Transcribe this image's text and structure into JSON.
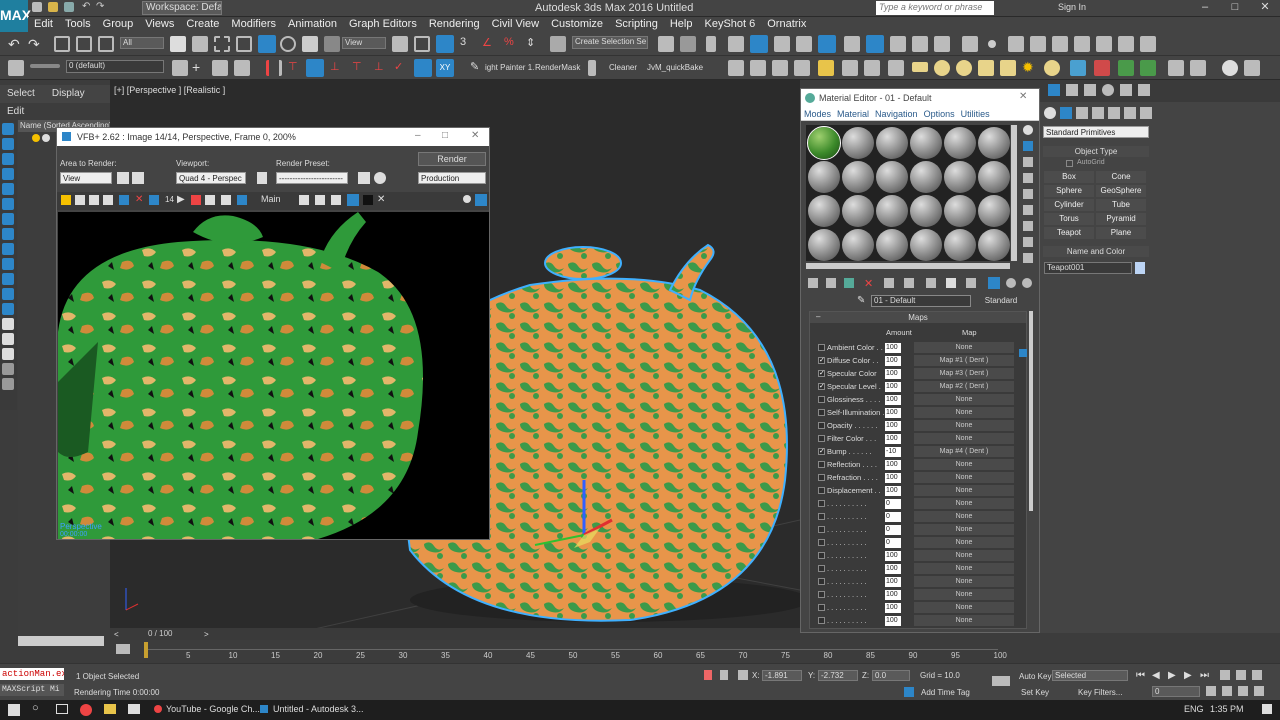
{
  "app": {
    "title": "Autodesk 3ds Max 2016    Untitled",
    "logo": "MAX",
    "workspace": "Workspace: Default",
    "search_placeholder": "Type a keyword or phrase",
    "sign_in": "Sign In"
  },
  "menu": [
    "Edit",
    "Tools",
    "Group",
    "Views",
    "Create",
    "Modifiers",
    "Animation",
    "Graph Editors",
    "Rendering",
    "Civil View",
    "Customize",
    "Scripting",
    "Help",
    "KeyShot 6",
    "Ornatrix"
  ],
  "toolbar": {
    "filter": "All",
    "view": "View",
    "create_selection_set": "Create Selection Se",
    "layer": "0 (default)",
    "scripts": [
      "ight Painter 1.",
      "RenderMask",
      "Cleaner",
      "JvM_quickBake"
    ]
  },
  "command_tabs": [
    "Select",
    "Display",
    "Edit"
  ],
  "scene_explorer": {
    "header": "Name (Sorted Ascending)"
  },
  "viewport": {
    "label": "[+] [Perspective ] [Realistic ]"
  },
  "vfb": {
    "title": "VFB+ 2.62 : Image 14/14, Perspective, Frame 0, 200%",
    "area_label": "Area to Render:",
    "area_value": "View",
    "viewport_label": "Viewport:",
    "viewport_value": "Quad 4 - Perspec",
    "preset_label": "Render Preset:",
    "preset_value": "------------------------",
    "render_button": "Render",
    "production": "Production",
    "frame_num": "14",
    "main_label": "Main",
    "overlay_view": "Perspective",
    "overlay_time": "00:00:00"
  },
  "material_editor": {
    "title": "Material Editor - 01 - Default",
    "menu": [
      "Modes",
      "Material",
      "Navigation",
      "Options",
      "Utilities"
    ],
    "material_name": "01 - Default",
    "material_type": "Standard",
    "maps_header": "Maps",
    "col_amount": "Amount",
    "col_map": "Map",
    "rows": [
      {
        "checked": false,
        "name": "Ambient Color . .",
        "amount": "100",
        "map": "None"
      },
      {
        "checked": true,
        "name": "Diffuse Color . .",
        "amount": "100",
        "map": "Map #1  ( Dent )"
      },
      {
        "checked": true,
        "name": "Specular Color",
        "amount": "100",
        "map": "Map #3  ( Dent )"
      },
      {
        "checked": true,
        "name": "Specular Level .",
        "amount": "100",
        "map": "Map #2  ( Dent )"
      },
      {
        "checked": false,
        "name": "Glossiness . . . .",
        "amount": "100",
        "map": "None"
      },
      {
        "checked": false,
        "name": "Self-Illumination .",
        "amount": "100",
        "map": "None"
      },
      {
        "checked": false,
        "name": "Opacity . . . . . .",
        "amount": "100",
        "map": "None"
      },
      {
        "checked": false,
        "name": "Filter Color . . .",
        "amount": "100",
        "map": "None"
      },
      {
        "checked": true,
        "name": "Bump . . . . . .",
        "amount": "-10",
        "map": "Map #4  ( Dent )"
      },
      {
        "checked": false,
        "name": "Reflection . . . .",
        "amount": "100",
        "map": "None"
      },
      {
        "checked": false,
        "name": "Refraction . . . .",
        "amount": "100",
        "map": "None"
      },
      {
        "checked": false,
        "name": "Displacement . .",
        "amount": "100",
        "map": "None"
      },
      {
        "checked": false,
        "name": ". . . . . . . . . .",
        "amount": "0",
        "map": "None"
      },
      {
        "checked": false,
        "name": ". . . . . . . . . .",
        "amount": "0",
        "map": "None"
      },
      {
        "checked": false,
        "name": ". . . . . . . . . .",
        "amount": "0",
        "map": "None"
      },
      {
        "checked": false,
        "name": ". . . . . . . . . .",
        "amount": "0",
        "map": "None"
      },
      {
        "checked": false,
        "name": ". . . . . . . . . .",
        "amount": "100",
        "map": "None"
      },
      {
        "checked": false,
        "name": ". . . . . . . . . .",
        "amount": "100",
        "map": "None"
      },
      {
        "checked": false,
        "name": ". . . . . . . . . .",
        "amount": "100",
        "map": "None"
      },
      {
        "checked": false,
        "name": ". . . . . . . . . .",
        "amount": "100",
        "map": "None"
      },
      {
        "checked": false,
        "name": ". . . . . . . . . .",
        "amount": "100",
        "map": "None"
      },
      {
        "checked": false,
        "name": ". . . . . . . . . .",
        "amount": "100",
        "map": "None"
      }
    ]
  },
  "command_panel": {
    "dropdown": "Standard Primitives",
    "object_type": "Object Type",
    "autogrid": "AutoGrid",
    "buttons": [
      "Box",
      "Cone",
      "Sphere",
      "GeoSphere",
      "Cylinder",
      "Tube",
      "Torus",
      "Pyramid",
      "Teapot",
      "Plane"
    ],
    "name_color": "Name and Color",
    "object_name": "Teapot001"
  },
  "timeline": {
    "slider": "0 / 100",
    "ticks": [
      "5",
      "10",
      "15",
      "20",
      "25",
      "30",
      "35",
      "40",
      "45",
      "50",
      "55",
      "60",
      "65",
      "70",
      "75",
      "80",
      "85",
      "90",
      "95",
      "100"
    ]
  },
  "status": {
    "script_a": "actionMan.exe",
    "script_b": "MAXScript Mi",
    "selected": "1 Object Selected",
    "render_time": "Rendering Time  0:00:00",
    "x_label": "X:",
    "x_value": "-1.891",
    "y_label": "Y:",
    "y_value": "-2.732",
    "z_label": "Z:",
    "z_value": "0.0",
    "grid": "Grid = 10.0",
    "add_time_tag": "Add Time Tag",
    "auto_key": "Auto Key",
    "set_key": "Set Key",
    "key_mode": "Selected",
    "key_filters": "Key Filters...",
    "frame": "0"
  },
  "taskbar": {
    "chrome": "YouTube - Google Ch...",
    "max": "Untitled - Autodesk 3...",
    "lang": "ENG",
    "time": "1:35 PM"
  },
  "colors": {
    "accent": "#2d86c8",
    "green": "#2f9a3a",
    "orange": "#e8954a"
  }
}
